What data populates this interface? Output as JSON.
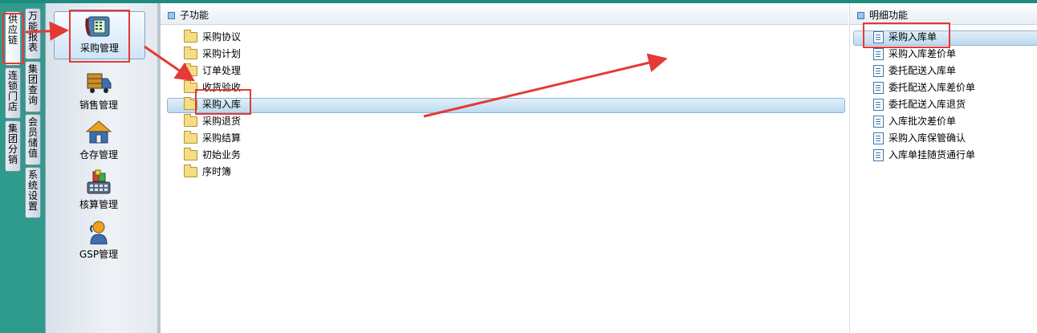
{
  "outer_tabs": [
    {
      "label": "供应链"
    },
    {
      "label": "万能报表"
    },
    {
      "label": "连锁门店"
    },
    {
      "label": "集团查询"
    },
    {
      "label": "集团分销"
    },
    {
      "label": "会员储值"
    },
    {
      "label": "系统设置"
    }
  ],
  "modules": [
    {
      "label": "采购管理",
      "icon": "purchase-phone-icon"
    },
    {
      "label": "销售管理",
      "icon": "delivery-truck-icon"
    },
    {
      "label": "仓存管理",
      "icon": "warehouse-house-icon"
    },
    {
      "label": "核算管理",
      "icon": "accounting-calculator-icon"
    },
    {
      "label": "GSP管理",
      "icon": "gsp-user-icon"
    }
  ],
  "sub_panel": {
    "title": "子功能",
    "items": [
      {
        "label": "采购协议"
      },
      {
        "label": "采购计划"
      },
      {
        "label": "订单处理"
      },
      {
        "label": "收货验收"
      },
      {
        "label": "采购入库"
      },
      {
        "label": "采购退货"
      },
      {
        "label": "采购结算"
      },
      {
        "label": "初始业务"
      },
      {
        "label": "序时簿"
      }
    ]
  },
  "detail_panel": {
    "title": "明细功能",
    "items": [
      {
        "label": "采购入库单"
      },
      {
        "label": "采购入库差价单"
      },
      {
        "label": "委托配送入库单"
      },
      {
        "label": "委托配送入库差价单"
      },
      {
        "label": "委托配送入库退货"
      },
      {
        "label": "入库批次差价单"
      },
      {
        "label": "采购入库保管确认"
      },
      {
        "label": "入库单挂随货通行单"
      }
    ]
  },
  "colors": {
    "annotation_red": "#e53935",
    "highlight_blue": "#bcd9ef",
    "teal_frame": "#2e9b8d"
  }
}
